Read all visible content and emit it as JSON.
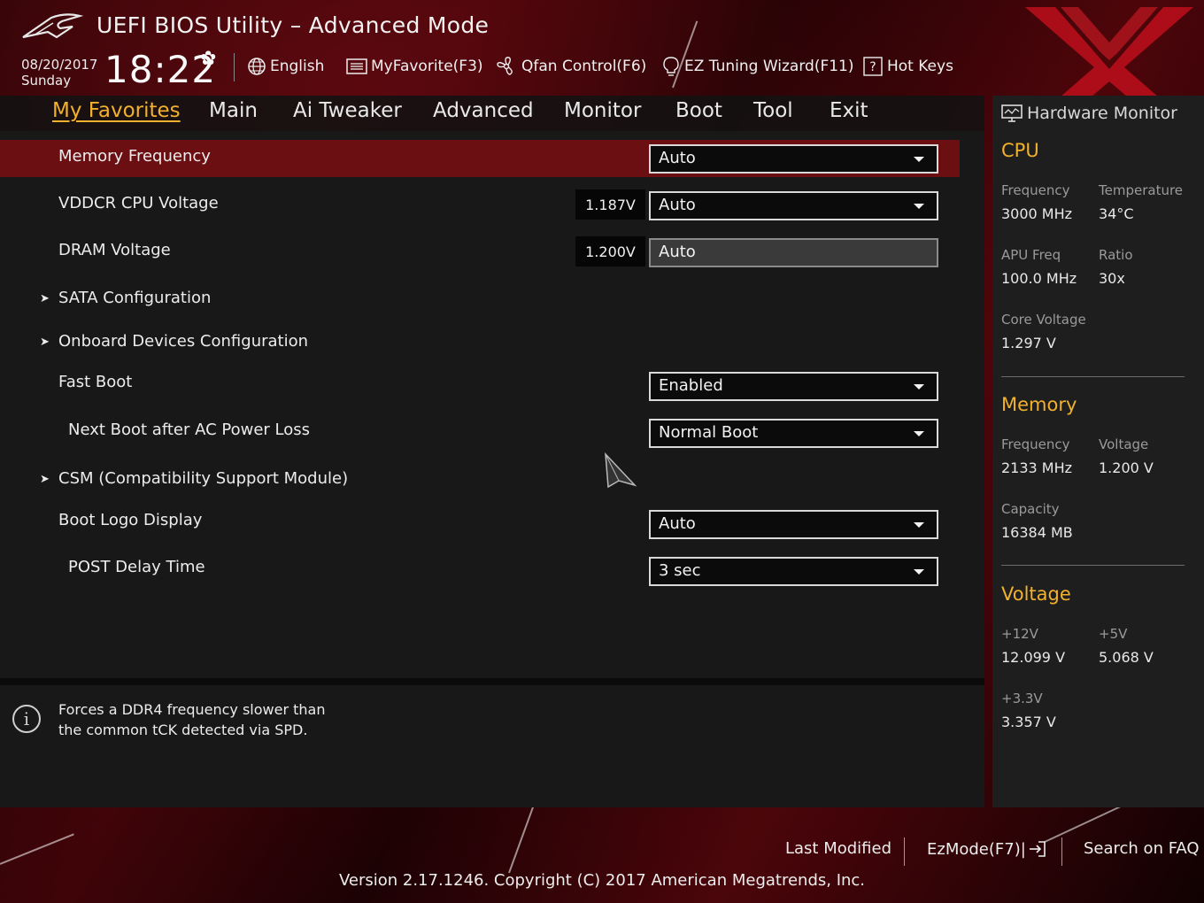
{
  "header": {
    "title": "UEFI BIOS Utility – Advanced Mode",
    "date": "08/20/2017",
    "day": "Sunday",
    "time": "18:22",
    "toolbar": [
      {
        "label": "English",
        "icon": "globe-icon"
      },
      {
        "label": "MyFavorite(F3)",
        "icon": "list-icon"
      },
      {
        "label": "Qfan Control(F6)",
        "icon": "fan-icon"
      },
      {
        "label": "EZ Tuning Wizard(F11)",
        "icon": "bulb-icon"
      },
      {
        "label": "Hot Keys",
        "icon": "help-box-icon"
      }
    ]
  },
  "nav": {
    "tabs": [
      "My Favorites",
      "Main",
      "Ai Tweaker",
      "Advanced",
      "Monitor",
      "Boot",
      "Tool",
      "Exit"
    ],
    "active": "My Favorites"
  },
  "settings": [
    {
      "label": "Memory Frequency",
      "value": "Auto",
      "selected": true
    },
    {
      "label": "VDDCR CPU Voltage",
      "reading": "1.187V",
      "value": "Auto"
    },
    {
      "label": "DRAM Voltage",
      "reading": "1.200V",
      "value": "Auto"
    },
    {
      "label": "SATA Configuration",
      "submenu": true
    },
    {
      "label": "Onboard Devices Configuration",
      "submenu": true
    },
    {
      "label": "Fast Boot",
      "value": "Enabled"
    },
    {
      "label": "Next Boot after AC Power Loss",
      "value": "Normal Boot"
    },
    {
      "label": "CSM (Compatibility Support Module)",
      "submenu": true
    },
    {
      "label": "Boot Logo Display",
      "value": "Auto"
    },
    {
      "label": "POST Delay Time",
      "value": "3 sec"
    }
  ],
  "help": {
    "line1": "Forces a DDR4 frequency slower than",
    "line2": "the common tCK detected via SPD."
  },
  "hardware_monitor": {
    "title": "Hardware Monitor",
    "cpu": {
      "heading": "CPU",
      "frequency_label": "Frequency",
      "frequency": "3000 MHz",
      "temperature_label": "Temperature",
      "temperature": "34°C",
      "apu_label": "APU Freq",
      "apu": "100.0 MHz",
      "ratio_label": "Ratio",
      "ratio": "30x",
      "core_voltage_label": "Core Voltage",
      "core_voltage": "1.297 V"
    },
    "memory": {
      "heading": "Memory",
      "frequency_label": "Frequency",
      "frequency": "2133 MHz",
      "voltage_label": "Voltage",
      "voltage": "1.200 V",
      "capacity_label": "Capacity",
      "capacity": "16384 MB"
    },
    "voltage": {
      "heading": "Voltage",
      "v12_label": "+12V",
      "v12": "12.099 V",
      "v5_label": "+5V",
      "v5": "5.068 V",
      "v33_label": "+3.3V",
      "v33": "3.357 V"
    }
  },
  "footer": {
    "last_modified": "Last Modified",
    "ezmode": "EzMode(F7)|",
    "search_faq": "Search on FAQ",
    "copyright": "Version 2.17.1246. Copyright (C) 2017 American Megatrends, Inc."
  },
  "colors": {
    "accent": "#f2b12c",
    "selected_row": "#6b0f12",
    "panel": "#181818",
    "brand_red": "#c8101c"
  }
}
